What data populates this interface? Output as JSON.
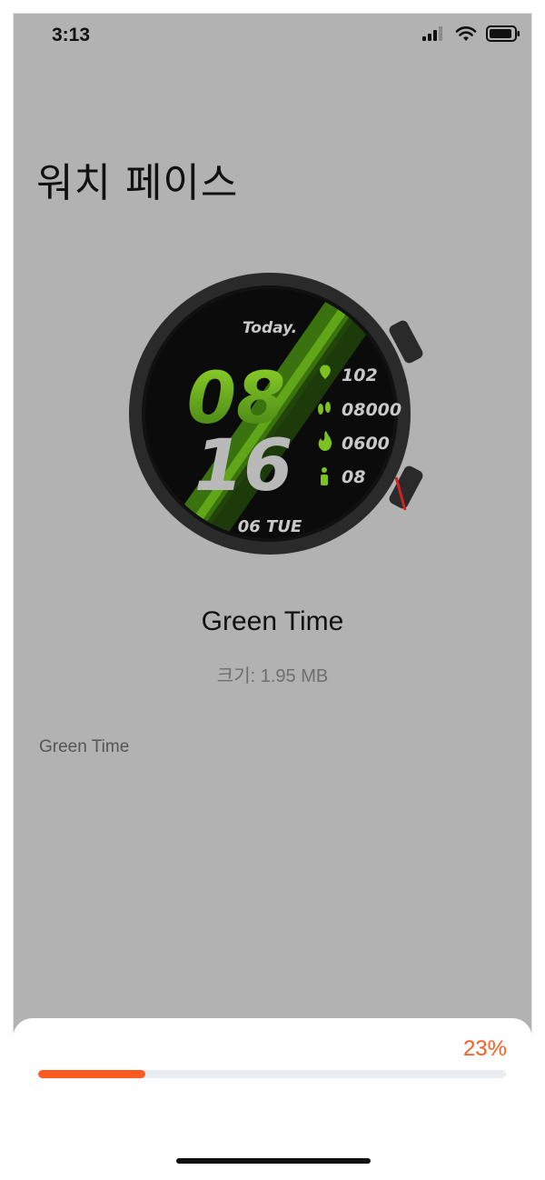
{
  "status_bar": {
    "time": "3:13"
  },
  "page": {
    "title": "워치 페이스"
  },
  "watch_face": {
    "name": "Green Time",
    "size_text": "크기: 1.95 MB",
    "description": "Green Time",
    "preview": {
      "today_label": "Today.",
      "hour": "08",
      "minute": "16",
      "heart_rate": "102",
      "steps": "08000",
      "calories": "0600",
      "stand": "08",
      "date": "06 TUE"
    }
  },
  "progress": {
    "percent_label": "23%",
    "value": 0.23
  },
  "colors": {
    "accent": "#ff5a1f",
    "watch_green": "#7cc31f",
    "backdrop": "#b2b2b2"
  }
}
